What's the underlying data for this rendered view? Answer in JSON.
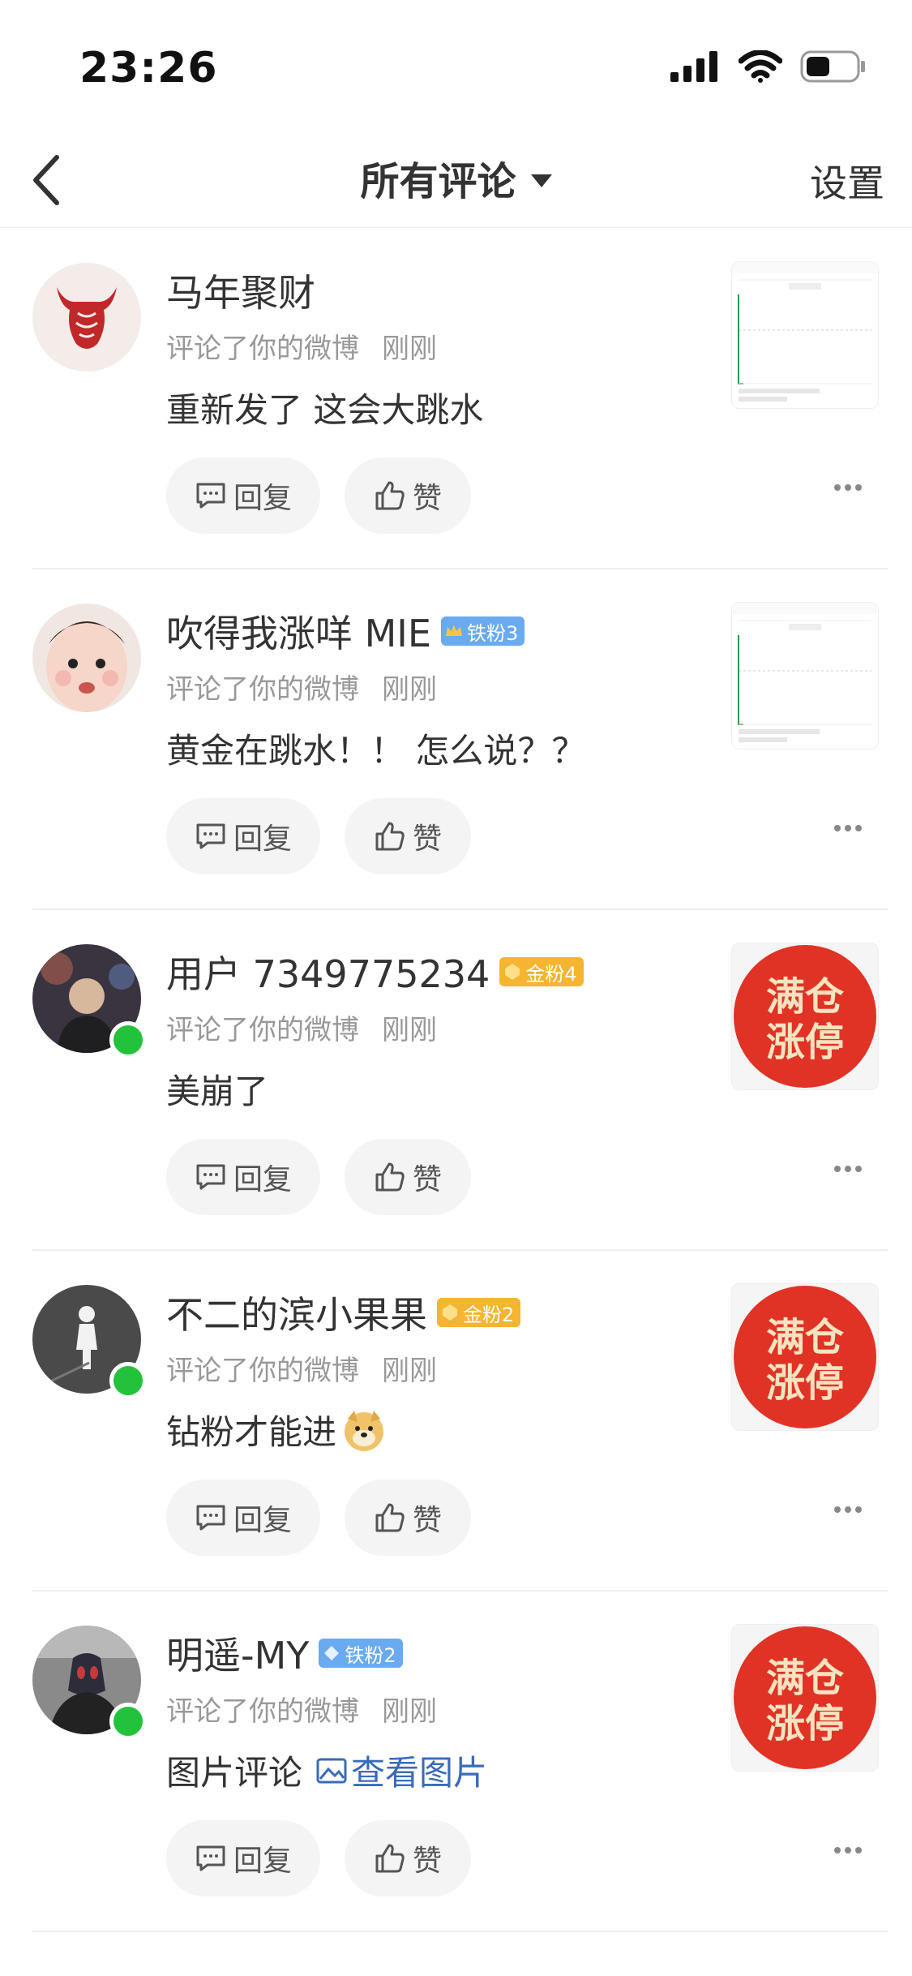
{
  "status": {
    "time": "23:26"
  },
  "nav": {
    "title": "所有评论",
    "settings": "设置"
  },
  "buttons": {
    "reply": "回复",
    "like": "赞"
  },
  "items": [
    {
      "username": "马年聚财",
      "action": "评论了你的微博",
      "time": "刚刚",
      "comment": "重新发了 这会大跳水",
      "online": false,
      "badge": null,
      "thumb": "chart"
    },
    {
      "username": "吹得我涨咩 MIE",
      "action": "评论了你的微博",
      "time": "刚刚",
      "comment": "黄金在跳水！！ 怎么说？？",
      "online": false,
      "badge": {
        "label": "铁粉3",
        "color": "#6aaaf0"
      },
      "thumb": "chart"
    },
    {
      "username": "用户 7349775234",
      "action": "评论了你的微博",
      "time": "刚刚",
      "comment": "美崩了",
      "online": true,
      "badge": {
        "label": "金粉4",
        "color": "#f5b531"
      },
      "thumb": "stamp"
    },
    {
      "username": "不二的滨小果果",
      "action": "评论了你的微博",
      "time": "刚刚",
      "comment": "钻粉才能进",
      "online": true,
      "badge": {
        "label": "金粉2",
        "color": "#f5b531"
      },
      "thumb": "stamp"
    },
    {
      "username": "明遥-MY",
      "action": "评论了你的微博",
      "time": "刚刚",
      "comment": "图片评论",
      "link": "查看图片",
      "online": true,
      "badge": {
        "label": "铁粉2",
        "color": "#6aaaf0"
      },
      "thumb": "stamp"
    }
  ],
  "stamp": {
    "line1": "满仓",
    "line2": "涨停"
  },
  "colors": {
    "online": "#22c33b",
    "link": "#3a6bb8",
    "stamp_red": "#e03325",
    "stamp_text": "#f6e3c0"
  }
}
